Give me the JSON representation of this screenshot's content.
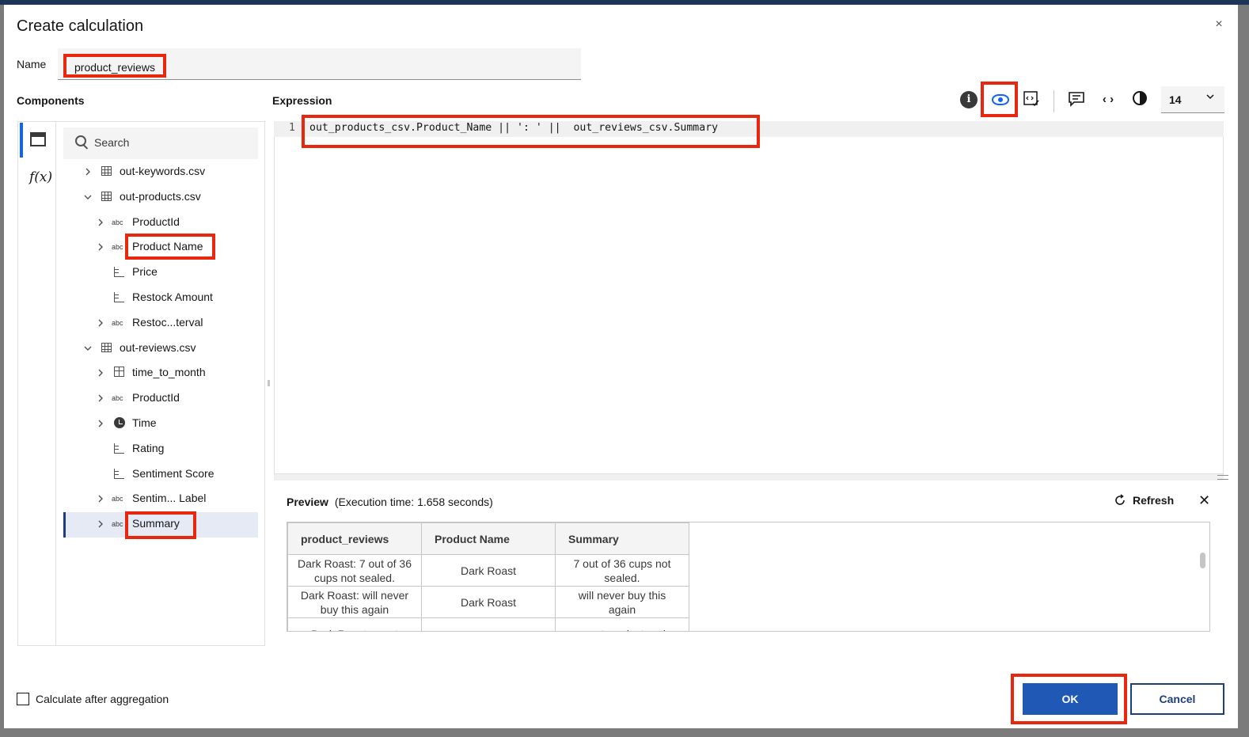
{
  "dialog": {
    "title": "Create calculation",
    "close_glyph": "×"
  },
  "name": {
    "label": "Name",
    "value": "product_reviews"
  },
  "components": {
    "label": "Components",
    "search_placeholder": "Search",
    "tree": [
      {
        "label": "out-keywords.csv",
        "icon": "table-icon",
        "expanded": false
      },
      {
        "label": "out-products.csv",
        "icon": "table-icon",
        "expanded": true
      },
      {
        "label": "ProductId",
        "icon": "abc-icon"
      },
      {
        "label": "Product Name",
        "icon": "abc-icon"
      },
      {
        "label": "Price",
        "icon": "measure-icon"
      },
      {
        "label": "Restock Amount",
        "icon": "measure-icon"
      },
      {
        "label": "Restoc...terval",
        "icon": "abc-icon"
      },
      {
        "label": "out-reviews.csv",
        "icon": "table-icon",
        "expanded": true
      },
      {
        "label": "time_to_month",
        "icon": "grid-icon"
      },
      {
        "label": "ProductId",
        "icon": "abc-icon"
      },
      {
        "label": "Time",
        "icon": "clock-icon"
      },
      {
        "label": "Rating",
        "icon": "measure-icon"
      },
      {
        "label": "Sentiment Score",
        "icon": "measure-icon"
      },
      {
        "label": "Sentim... Label",
        "icon": "abc-icon"
      },
      {
        "label": "Summary",
        "icon": "abc-icon"
      }
    ],
    "abc_text": "abc",
    "fx_text": "f(x)"
  },
  "expression": {
    "label": "Expression",
    "line_number": "1",
    "code": "out_products_csv.Product_Name || ': ' ||  out_reviews_csv.Summary"
  },
  "toolbar": {
    "info_glyph": "i",
    "code_glyph": "‹ ›",
    "font_size": "14",
    "chevron": "⌄"
  },
  "preview": {
    "label": "Preview",
    "execution_time": "(Execution time: 1.658 seconds)",
    "refresh_label": "Refresh",
    "close_glyph": "✕",
    "columns": [
      "product_reviews",
      "Product Name",
      "Summary"
    ],
    "rows": [
      [
        "Dark Roast: 7 out of 36 cups not sealed.",
        "Dark Roast",
        "7 out of 36 cups not sealed."
      ],
      [
        "Dark Roast: will never buy this again",
        "Dark Roast",
        "will never buy this again"
      ],
      [
        "Dark Roast: great",
        "",
        "great product and"
      ]
    ]
  },
  "footer": {
    "checkbox_label": "Calculate after aggregation",
    "ok_label": "OK",
    "cancel_label": "Cancel"
  },
  "colors": {
    "highlight": "#e8280e",
    "primary_button": "#1f59b5",
    "accent": "#0f62fe"
  }
}
